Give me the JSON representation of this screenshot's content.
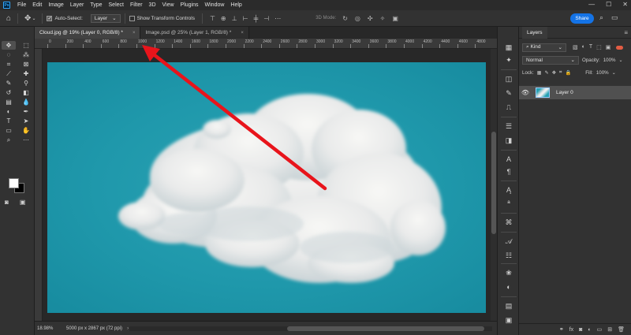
{
  "menu": {
    "app_icon": "Ps",
    "items": [
      "File",
      "Edit",
      "Image",
      "Layer",
      "Type",
      "Select",
      "Filter",
      "3D",
      "View",
      "Plugins",
      "Window",
      "Help"
    ],
    "window_controls": [
      "—",
      "☐",
      "✕"
    ]
  },
  "options": {
    "auto_select_label": "Auto-Select:",
    "auto_select_checked": true,
    "layer_select_value": "Layer",
    "transform_controls_label": "Show Transform Controls",
    "transform_controls_checked": false,
    "threed_mode_label": "3D Mode:",
    "share_label": "Share"
  },
  "tabs": [
    {
      "label": "Cloud.jpg @ 19% (Layer 0, RGB/8) *",
      "active": true,
      "close": "×"
    },
    {
      "label": "Image.psd @ 25% (Layer 1, RGB/8) *",
      "active": false,
      "close": "×"
    }
  ],
  "ruler": {
    "ticks": [
      "0",
      "200",
      "400",
      "600",
      "800",
      "1000",
      "1200",
      "1400",
      "1600",
      "1800",
      "2000",
      "2200",
      "2400",
      "2600",
      "2800",
      "3000",
      "3200",
      "3400",
      "3600",
      "3800",
      "4000",
      "4200",
      "4400",
      "4600",
      "4800"
    ]
  },
  "status": {
    "zoom": "18.98%",
    "doc_size": "5000 px x 2867 px (72 ppi)",
    "chevron": "›"
  },
  "layers_panel": {
    "tab_label": "Layers",
    "kind_label": "Kind",
    "blend_mode": "Normal",
    "opacity_label": "Opacity:",
    "opacity_value": "100%",
    "lock_label": "Lock:",
    "fill_label": "Fill:",
    "fill_value": "100%",
    "layers": [
      {
        "name": "Layer 0",
        "visible": true,
        "selected": true
      }
    ]
  },
  "colors": {
    "accent": "#1473e6",
    "canvas_bg": "#1f98ab",
    "annotation_arrow": "#e8141b"
  }
}
